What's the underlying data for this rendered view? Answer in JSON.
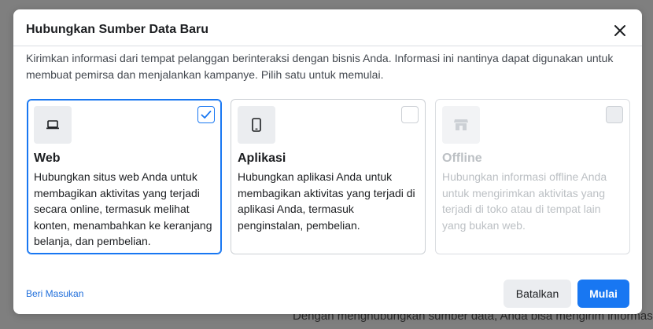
{
  "background": {
    "partial_text": "Dengan menghubungkan sumber data, Anda bisa mengirim informasi dari"
  },
  "dialog": {
    "title": "Hubungkan Sumber Data Baru",
    "close_icon": "close-icon",
    "description": "Kirimkan informasi dari tempat pelanggan berinteraksi dengan bisnis Anda. Informasi ini nantinya dapat digunakan untuk membuat pemirsa dan menjalankan kampanye. Pilih satu untuk memulai.",
    "options": [
      {
        "icon": "laptop-icon",
        "title": "Web",
        "description": "Hubungkan situs web Anda untuk membagikan aktivitas yang terjadi secara online, termasuk melihat konten, menambahkan ke keranjang belanja, dan pembelian.",
        "selected": true,
        "disabled": false
      },
      {
        "icon": "mobile-phone-icon",
        "title": "Aplikasi",
        "description": "Hubungkan aplikasi Anda untuk membagikan aktivitas yang terjadi di aplikasi Anda, termasuk penginstalan, pembelian.",
        "selected": false,
        "disabled": false
      },
      {
        "icon": "store-icon",
        "title": "Offline",
        "description": "Hubungkan informasi offline Anda untuk mengirimkan aktivitas yang terjadi di toko atau di tempat lain yang bukan web.",
        "selected": false,
        "disabled": true
      }
    ],
    "feedback_link": "Beri Masukan",
    "cancel_label": "Batalkan",
    "primary_label": "Mulai"
  },
  "colors": {
    "accent": "#1877f2",
    "link": "#216fdb",
    "overlay": "#7f7f7f"
  }
}
